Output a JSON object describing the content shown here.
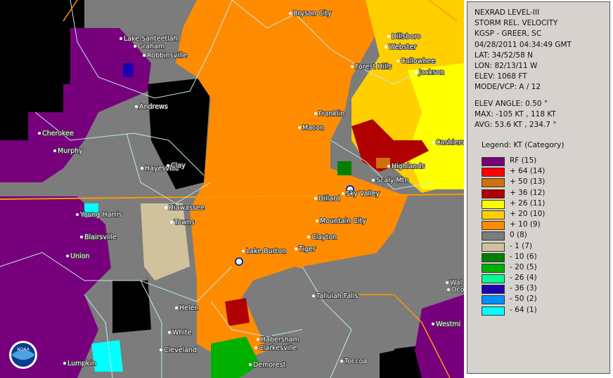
{
  "header": {
    "lines": [
      "NEXRAD LEVEL-III",
      "STORM REL. VELOCITY",
      "KGSP - GREER, SC",
      "04/28/2011 04:34:49 GMT",
      "LAT: 34/52/58 N",
      "LON: 82/13/11 W",
      "ELEV: 1068 FT",
      "MODE/VCP: A / 12"
    ]
  },
  "stats": {
    "lines": [
      "ELEV ANGLE: 0.50 °",
      "MAX: -105 KT , 118 KT",
      "AVG: 53.6 KT , 234.7 °"
    ]
  },
  "legend": {
    "title": "Legend: KT (Category)",
    "items": [
      {
        "label": "RF  (15)",
        "color": "#77007d"
      },
      {
        "label": "+ 64  (14)",
        "color": "#ff0000"
      },
      {
        "label": "+ 50  (13)",
        "color": "#d0700c"
      },
      {
        "label": "+ 36  (12)",
        "color": "#b00000"
      },
      {
        "label": "+ 26  (11)",
        "color": "#ffff00"
      },
      {
        "label": "+ 20  (10)",
        "color": "#ffcf00"
      },
      {
        "label": "+ 10  (9)",
        "color": "#ff8c00"
      },
      {
        "label": "0  (8)",
        "color": "#7c7c7c"
      },
      {
        "label": "- 1  (7)",
        "color": "#d1c29e"
      },
      {
        "label": "- 10  (6)",
        "color": "#008000"
      },
      {
        "label": "- 20  (5)",
        "color": "#00b000"
      },
      {
        "label": "- 26  (4)",
        "color": "#00fb90"
      },
      {
        "label": "- 36  (3)",
        "color": "#1e00b0"
      },
      {
        "label": "- 50  (2)",
        "color": "#0090ff"
      },
      {
        "label": "- 64  (1)",
        "color": "#00ffff"
      }
    ]
  },
  "map": {
    "logo": "noaa-logo",
    "cities": [
      "Bryson City",
      "Lake Santeetlah",
      "Graham",
      "Robbinsville",
      "Dillsboro",
      "Webster",
      "Forest Hills",
      "Cullowhee",
      "Jackson",
      "Andrews",
      "Franklin",
      "Macon",
      "Cherokee",
      "Murphy",
      "Cashiers",
      "Hayesville",
      "Clay",
      "Highlands",
      "Scaly Mtn",
      "Sky Valley",
      "Dillard",
      "Hiawassee",
      "Young Harris",
      "Towns",
      "Mountain City",
      "Blairsville",
      "Clayton",
      "Union",
      "Lake Burton",
      "Tiger",
      "Tallulah Falls",
      "Helen",
      "White",
      "Habersham",
      "Clarkesville",
      "Cleveland",
      "Lumpkin",
      "Demorest",
      "Toccoa",
      "Westmi",
      "Wal",
      "Oco"
    ]
  }
}
